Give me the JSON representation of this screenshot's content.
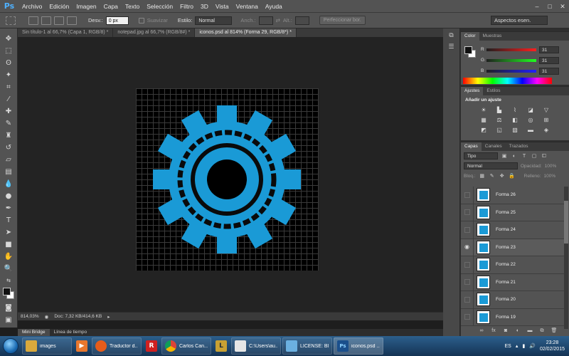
{
  "app": {
    "logo": "Ps",
    "menu": [
      "Archivo",
      "Edición",
      "Imagen",
      "Capa",
      "Texto",
      "Selección",
      "Filtro",
      "3D",
      "Vista",
      "Ventana",
      "Ayuda"
    ],
    "window_controls": [
      "–",
      "□",
      "✕"
    ]
  },
  "options": {
    "desv_label": "Desv.:",
    "desv_value": "0 px",
    "suavizar": "Suavizar",
    "estilo_label": "Estilo:",
    "estilo_value": "Normal",
    "anch_label": "Anch.:",
    "alt_label": "Alt.:",
    "refine_button": "Perfeccionar bor.",
    "workspace": "Aspectos esen."
  },
  "tabs": [
    "Sin título-1 al 66,7% (Capa 1, RGB/8) *",
    "notepad.jpg al 66,7% (RGB/8#) *",
    "iconos.psd al 814% (Forma 29, RGB/8*) *"
  ],
  "status": {
    "zoom": "814,03%",
    "doc": "Doc: 7,32 KB/414,6 KB"
  },
  "bottom_tabs": [
    "Mini Bridge",
    "Línea de tiempo"
  ],
  "color_panel": {
    "tabs": [
      "Color",
      "Muestras"
    ],
    "r_label": "R",
    "r_value": "31",
    "g_label": "G",
    "g_value": "31",
    "b_label": "B",
    "b_value": "31"
  },
  "adjust_panel": {
    "tabs": [
      "Ajustes",
      "Estilos"
    ],
    "title": "Añadir un ajuste"
  },
  "layers_panel": {
    "tabs": [
      "Capas",
      "Canales",
      "Trazados"
    ],
    "filter": "Tipo",
    "blend": "Normal",
    "opacity_label": "Opacidad:",
    "opacity_value": "100%",
    "lock_label": "Bloq.:",
    "fill_label": "Relleno:",
    "fill_value": "100%",
    "layers": [
      {
        "name": "Forma 26",
        "visible": false
      },
      {
        "name": "Forma 25",
        "visible": false
      },
      {
        "name": "Forma 24",
        "visible": false
      },
      {
        "name": "Forma 23",
        "visible": true
      },
      {
        "name": "Forma 22",
        "visible": false
      },
      {
        "name": "Forma 21",
        "visible": false
      },
      {
        "name": "Forma 20",
        "visible": false
      },
      {
        "name": "Forma 19",
        "visible": false
      }
    ]
  },
  "taskbar": {
    "items": [
      {
        "label": "images",
        "color": "#d9a93c"
      },
      {
        "label": "",
        "color": "#e8772e"
      },
      {
        "label": "Traductor d...",
        "color": "#e65c1b"
      },
      {
        "label": "",
        "color": "#d02020"
      },
      {
        "label": "Carlos Can...",
        "color": "#3c9d3c"
      },
      {
        "label": "",
        "color": "#c8a133"
      },
      {
        "label": "C:\\Users\\au...",
        "color": "#e6e6e6"
      },
      {
        "label": "LICENSE: Bl...",
        "color": "#6bb0e0"
      },
      {
        "label": "iconos.psd ...",
        "color": "#1a4f8c"
      }
    ],
    "lang": "ES",
    "time": "23:28",
    "date": "02/02/2015"
  },
  "colors": {
    "gear": "#1a9ad6",
    "accent": "#4eb1ff"
  }
}
